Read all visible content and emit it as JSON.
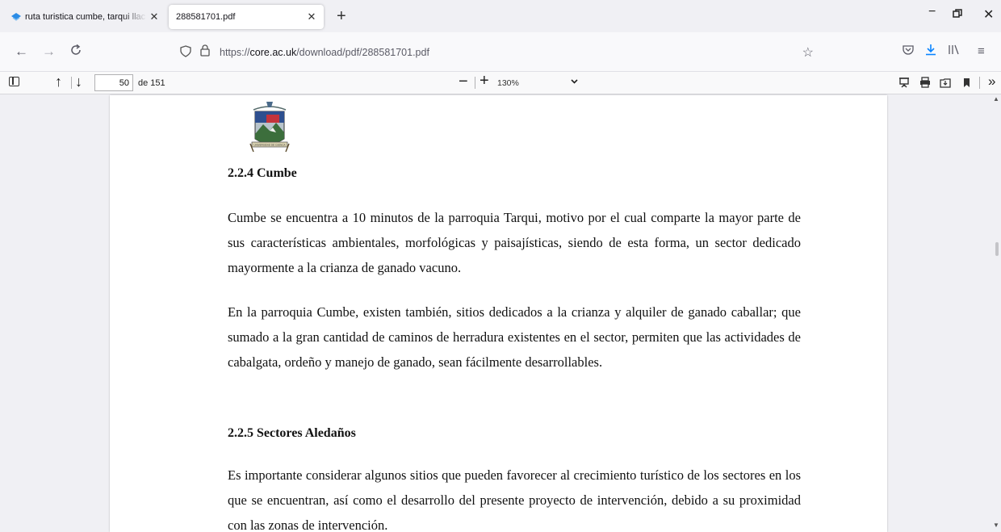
{
  "tabs": [
    {
      "label": "ruta turistica cumbe, tarqui llac",
      "favicon": "site-icon",
      "active": false
    },
    {
      "label": "288581701.pdf",
      "favicon": "",
      "active": true
    }
  ],
  "nav": {
    "url_prefix": "https://",
    "url_host": "core.ac.uk",
    "url_path": "/download/pdf/288581701.pdf"
  },
  "pdf_toolbar": {
    "page_number": "50",
    "page_total": "de 151",
    "zoom": "130%"
  },
  "document": {
    "heading1": "2.2.4 Cumbe",
    "para1": "Cumbe se encuentra a 10 minutos de la parroquia Tarqui, motivo por el cual comparte la mayor parte de sus características ambientales, morfológicas y paisajísticas, siendo de esta forma, un sector dedicado mayormente a la crianza de ganado vacuno.",
    "para2": "En la parroquia Cumbe, existen también, sitios dedicados a la crianza y alquiler de ganado caballar; que sumado a la gran cantidad de caminos de herradura existentes en el sector, permiten que las actividades de cabalgata, ordeño y manejo de ganado, sean fácilmente desarrollables.",
    "heading2": "2.2.5 Sectores Aledaños",
    "para3": "Es importante considerar algunos sitios que pueden favorecer al crecimiento turístico de los sectores en los que se encuentran, así como el desarrollo del presente proyecto de intervención, debido a su proximidad con las zonas de intervención.",
    "crest_caption": "UNIVERSIDAD DE CUENCA"
  },
  "colors": {
    "accent": "#0a84ff",
    "page_bg": "#ffffff",
    "viewer_bg": "#f0f0f4"
  }
}
